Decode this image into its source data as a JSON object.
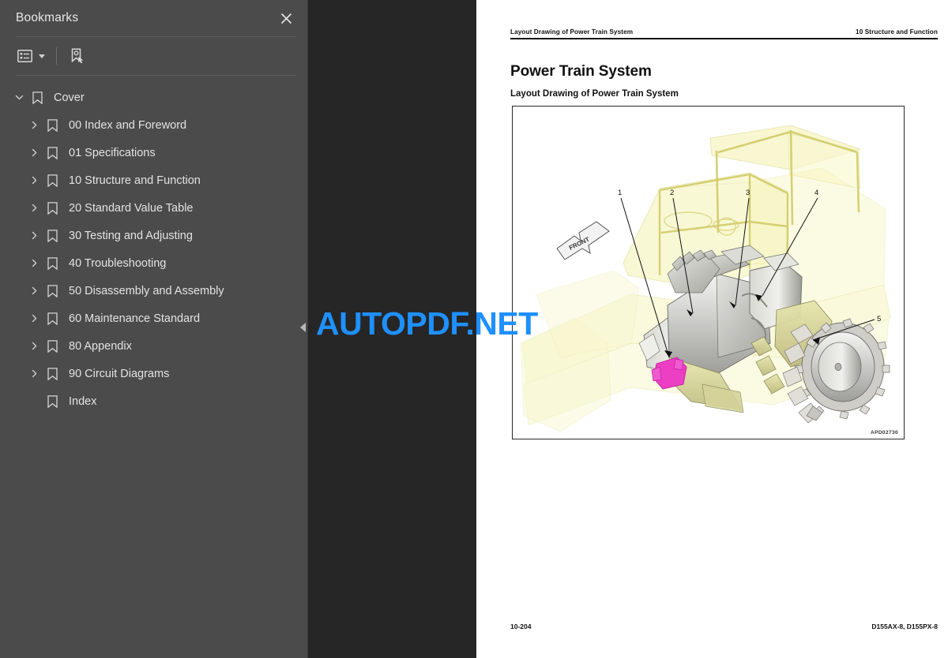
{
  "sidebar": {
    "title": "Bookmarks",
    "close_icon": "close-icon",
    "toolbar": {
      "options_label": "Bookmark options",
      "options_icon": "list-options-icon",
      "caret_icon": "chevron-down-icon",
      "new_bookmark_label": "New bookmark",
      "new_bookmark_icon": "add-bookmark-icon"
    },
    "collapse_handle_icon": "collapse-left-icon",
    "items": [
      {
        "label": "Cover",
        "level": 0,
        "expanded": true,
        "has_children": true
      },
      {
        "label": "00 Index and Foreword",
        "level": 1,
        "expanded": false,
        "has_children": true
      },
      {
        "label": "01 Specifications",
        "level": 1,
        "expanded": false,
        "has_children": true
      },
      {
        "label": "10 Structure and Function",
        "level": 1,
        "expanded": false,
        "has_children": true
      },
      {
        "label": "20 Standard Value Table",
        "level": 1,
        "expanded": false,
        "has_children": true
      },
      {
        "label": "30 Testing and Adjusting",
        "level": 1,
        "expanded": false,
        "has_children": true
      },
      {
        "label": "40 Troubleshooting",
        "level": 1,
        "expanded": false,
        "has_children": true
      },
      {
        "label": "50 Disassembly and Assembly",
        "level": 1,
        "expanded": false,
        "has_children": true
      },
      {
        "label": "60 Maintenance Standard",
        "level": 1,
        "expanded": false,
        "has_children": true
      },
      {
        "label": "80 Appendix",
        "level": 1,
        "expanded": false,
        "has_children": true
      },
      {
        "label": "90 Circuit Diagrams",
        "level": 1,
        "expanded": false,
        "has_children": true
      },
      {
        "label": "Index",
        "level": 1,
        "expanded": false,
        "has_children": false
      }
    ]
  },
  "watermark": {
    "text": "AUTOPDF.NET",
    "color": "#1e90ff"
  },
  "document": {
    "header_left": "Layout Drawing of Power Train System",
    "header_right": "10 Structure and Function",
    "heading": "Power Train System",
    "subheading": "Layout Drawing of Power Train System",
    "footer_left": "10-204",
    "footer_right": "D155AX-8, D155PX-8",
    "figure": {
      "code": "APD02730",
      "direction_label": "FRONT",
      "callouts": [
        "1",
        "2",
        "3",
        "4",
        "5"
      ],
      "highlight_color": "#ec3fc4",
      "machine_color": "#f2f0a8"
    }
  },
  "colors": {
    "sidebar_bg": "#4b4b4b",
    "viewer_bg": "#262626",
    "page_bg": "#ffffff",
    "text": "#e3e3e3",
    "accent": "#1e90ff"
  }
}
